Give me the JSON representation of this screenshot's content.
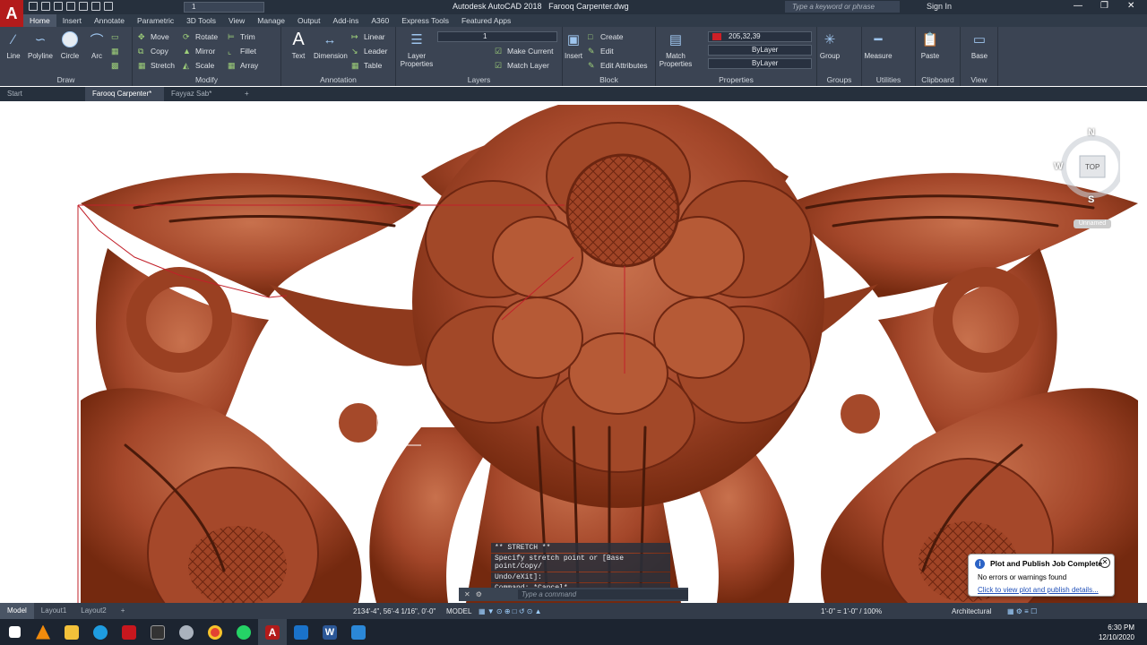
{
  "titlebar": {
    "logo": "A",
    "workspace": "1",
    "app_title": "Autodesk AutoCAD 2018",
    "file_title": "Farooq Carpenter.dwg",
    "search_placeholder": "Type a keyword or phrase",
    "signin": "Sign In"
  },
  "ribbon_tabs": [
    "Home",
    "Insert",
    "Annotate",
    "Parametric",
    "3D Tools",
    "View",
    "Manage",
    "Output",
    "Add-ins",
    "A360",
    "Express Tools",
    "Featured Apps"
  ],
  "draw": {
    "title": "Draw",
    "line": "Line",
    "polyline": "Polyline",
    "circle": "Circle",
    "arc": "Arc"
  },
  "modify": {
    "title": "Modify",
    "move": "Move",
    "rotate": "Rotate",
    "trim": "Trim",
    "copy": "Copy",
    "mirror": "Mirror",
    "fillet": "Fillet",
    "stretch": "Stretch",
    "scale": "Scale",
    "array": "Array"
  },
  "annotation": {
    "title": "Annotation",
    "text": "Text",
    "dimension": "Dimension",
    "linear": "Linear",
    "leader": "Leader",
    "table": "Table"
  },
  "layers": {
    "title": "Layers",
    "layer_properties": "Layer Properties",
    "layer_value": "1",
    "make_current": "Make Current",
    "match_layer": "Match Layer"
  },
  "block": {
    "title": "Block",
    "insert": "Insert",
    "create": "Create",
    "edit": "Edit",
    "edit_attributes": "Edit Attributes"
  },
  "properties": {
    "title": "Properties",
    "match": "Match Properties",
    "color": "205,32,39",
    "color_hex": "#cd2027",
    "linetype": "ByLayer",
    "lineweight": "ByLayer"
  },
  "groups": {
    "title": "Groups",
    "group": "Group"
  },
  "utilities": {
    "title": "Utilities",
    "measure": "Measure"
  },
  "clipboard": {
    "title": "Clipboard",
    "paste": "Paste"
  },
  "view": {
    "title": "View",
    "base": "Base"
  },
  "doc_tabs": [
    "Start",
    "Farooq Carpenter*",
    "Fayyaz Sab*"
  ],
  "viewcube": {
    "n": "N",
    "s": "S",
    "w": "W",
    "top": "TOP",
    "ucs": "Unnamed"
  },
  "command": {
    "line1": "** STRETCH **",
    "line2": "Specify stretch point or [Base point/Copy/",
    "line3": "Undo/eXit]:",
    "line4": "Command: *Cancel*",
    "placeholder": "Type a command"
  },
  "notification": {
    "title": "Plot and Publish Job Complete",
    "body": "No errors or warnings found",
    "link": "Click to view plot and publish details..."
  },
  "statusbar": {
    "layouts": [
      "Model",
      "Layout1",
      "Layout2"
    ],
    "coords": "2134'-4\", 56'-4 1/16\", 0'-0\"",
    "mode": "MODEL",
    "scale": "1'-0\" = 1'-0\" / 100%",
    "units": "Architectural"
  },
  "clock": {
    "time": "6:30 PM",
    "date": "12/10/2020"
  },
  "colors": {
    "wood_dark": "#7a2e17",
    "wood_mid": "#a8492a",
    "wood_light": "#c9704c"
  }
}
